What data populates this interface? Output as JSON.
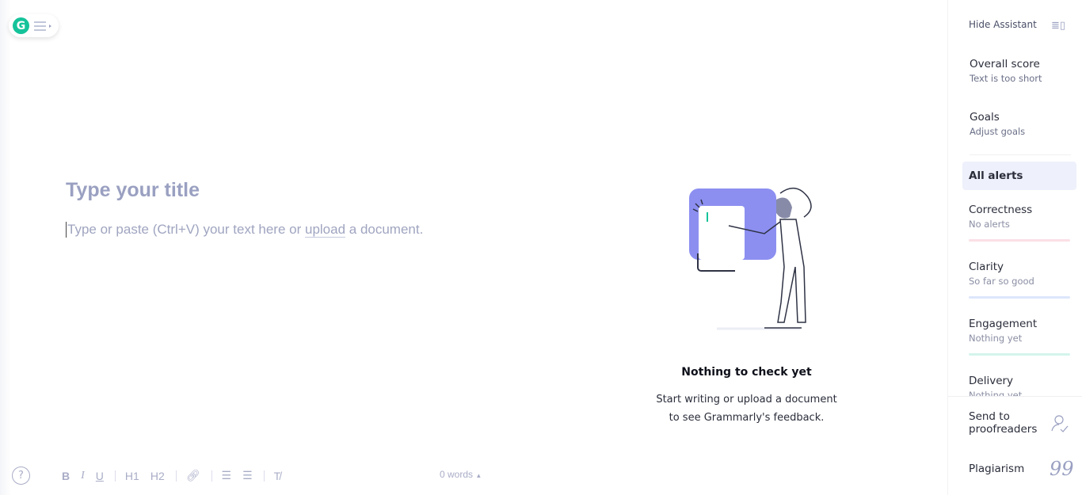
{
  "editor": {
    "title_placeholder": "Type your title",
    "body_before": "Type or paste (Ctrl+V) your text here or ",
    "body_link": "upload",
    "body_after": " a document.",
    "word_count": "0 words"
  },
  "toolbar": {
    "help": "?",
    "bold": "B",
    "italic": "I",
    "underline": "U",
    "h1": "H1",
    "h2": "H2"
  },
  "empty_state": {
    "heading": "Nothing to check yet",
    "line1": "Start writing or upload a document",
    "line2": "to see Grammarly's feedback."
  },
  "assistant": {
    "hide_label": "Hide Assistant",
    "overall": {
      "title": "Overall score",
      "sub": "Text is too short"
    },
    "goals": {
      "title": "Goals",
      "sub": "Adjust goals"
    },
    "all_alerts": "All alerts",
    "categories": [
      {
        "title": "Correctness",
        "sub": "No alerts",
        "color": "#fbe0e6"
      },
      {
        "title": "Clarity",
        "sub": "So far so good",
        "color": "#dde6fb"
      },
      {
        "title": "Engagement",
        "sub": "Nothing yet",
        "color": "#d4f5ec"
      },
      {
        "title": "Delivery",
        "sub": "Nothing yet",
        "color": "#ece8fb"
      }
    ],
    "send": "Send to proofreaders",
    "plagiarism": "Plagiarism"
  },
  "colors": {
    "brand": "#15c39a",
    "accent": "#8c8ff0"
  }
}
